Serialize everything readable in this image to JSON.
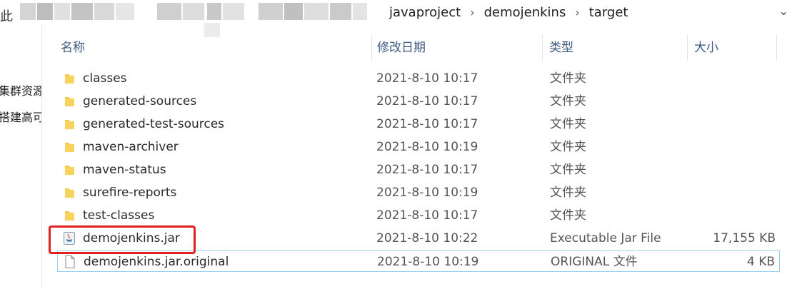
{
  "address_bar": {
    "lead_glyph": "此",
    "breadcrumbs": [
      "javaproject",
      "demojenkins",
      "target"
    ],
    "separator": "›",
    "dropdown_glyph": "⌄"
  },
  "nav_pane": {
    "items": [
      "集群资源",
      "搭建高可"
    ]
  },
  "columns": {
    "name": "名称",
    "date": "修改日期",
    "type": "类型",
    "size": "大小"
  },
  "files": [
    {
      "name": "classes",
      "date": "2021-8-10 10:17",
      "type": "文件夹",
      "size": "",
      "icon": "folder-icon"
    },
    {
      "name": "generated-sources",
      "date": "2021-8-10 10:17",
      "type": "文件夹",
      "size": "",
      "icon": "folder-icon"
    },
    {
      "name": "generated-test-sources",
      "date": "2021-8-10 10:17",
      "type": "文件夹",
      "size": "",
      "icon": "folder-icon"
    },
    {
      "name": "maven-archiver",
      "date": "2021-8-10 10:19",
      "type": "文件夹",
      "size": "",
      "icon": "folder-icon"
    },
    {
      "name": "maven-status",
      "date": "2021-8-10 10:17",
      "type": "文件夹",
      "size": "",
      "icon": "folder-icon"
    },
    {
      "name": "surefire-reports",
      "date": "2021-8-10 10:19",
      "type": "文件夹",
      "size": "",
      "icon": "folder-icon"
    },
    {
      "name": "test-classes",
      "date": "2021-8-10 10:17",
      "type": "文件夹",
      "size": "",
      "icon": "folder-icon"
    },
    {
      "name": "demojenkins.jar",
      "date": "2021-8-10 10:22",
      "type": "Executable Jar File",
      "size": "17,155 KB",
      "icon": "java-jar-icon"
    },
    {
      "name": "demojenkins.jar.original",
      "date": "2021-8-10 10:19",
      "type": "ORIGINAL 文件",
      "size": "4 KB",
      "icon": "blank-file-icon"
    }
  ],
  "colors": {
    "header_text": "#3d5a80",
    "folder_yellow": "#f4c542",
    "selection_border": "#99d1ef",
    "annotation_red": "#e02020"
  }
}
